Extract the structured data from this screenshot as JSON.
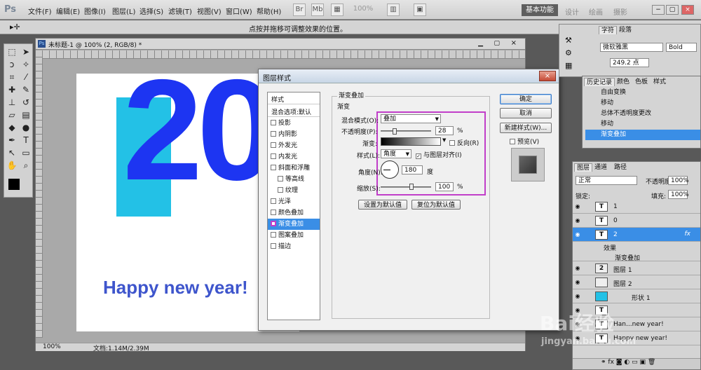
{
  "menubar": {
    "logo": "Ps",
    "items": [
      "文件(F)",
      "编辑(E)",
      "图像(I)",
      "图层(L)",
      "选择(S)",
      "滤镜(T)",
      "视图(V)",
      "窗口(W)",
      "帮助(H)"
    ],
    "zoom": "100%",
    "workspace_active": "基本功能",
    "workspaces": [
      "设计",
      "绘画",
      "摄影"
    ]
  },
  "optbar": {
    "hint": "点按并拖移可调整效果的位置。"
  },
  "document": {
    "tab_title": "未标题-1 @ 100% (2, RGB/8) *",
    "big_text": "20",
    "happy_text": "Happy new year!",
    "status_zoom": "100%",
    "status_doc": "文档:1.14M/2.39M"
  },
  "dialog": {
    "title": "图层样式",
    "close": "×",
    "styles_header": "样式",
    "blend_header": "混合选项:默认",
    "styles": [
      "投影",
      "内阴影",
      "外发光",
      "内发光",
      "斜面和浮雕",
      "等高线",
      "纹理",
      "光泽",
      "颜色叠加",
      "渐变叠加",
      "图案叠加",
      "描边"
    ],
    "selected_style": "渐变叠加",
    "group_title": "渐变叠加",
    "sub_title": "渐变",
    "blend_label": "混合模式(O):",
    "blend_value": "叠加",
    "opacity_label": "不透明度(P):",
    "opacity_value": "28",
    "opacity_unit": "%",
    "gradient_label": "渐变:",
    "reverse_label": "反向(R)",
    "style_label": "样式(L):",
    "style_value": "角度",
    "align_label": "与图层对齐(I)",
    "angle_label": "角度(N):",
    "angle_value": "180",
    "angle_unit": "度",
    "scale_label": "缩放(S):",
    "scale_value": "100",
    "scale_unit": "%",
    "btn_default": "设置为默认值",
    "btn_reset": "复位为默认值",
    "btn_ok": "确定",
    "btn_cancel": "取消",
    "btn_newstyle": "新建样式(W)...",
    "preview_label": "预览(V)"
  },
  "char_panel": {
    "tabs": [
      "字符",
      "段落"
    ],
    "font": "微软雅黑",
    "weight": "Bold",
    "size": "249.2 点"
  },
  "history_panel": {
    "tabs": [
      "历史记录",
      "颜色",
      "色板",
      "样式"
    ],
    "items": [
      "自由变换",
      "移动",
      "总体不透明度更改",
      "移动",
      "渐变叠加"
    ],
    "selected": "渐变叠加"
  },
  "layers_panel": {
    "tabs": [
      "图层",
      "通道",
      "路径"
    ],
    "blend": "正常",
    "opacity_label": "不透明度:",
    "opacity": "100%",
    "lock_label": "锁定:",
    "fill_label": "填充:",
    "fill": "100%",
    "layers": [
      {
        "name": "1",
        "kind": "T"
      },
      {
        "name": "0",
        "kind": "T"
      },
      {
        "name": "2",
        "kind": "T"
      },
      {
        "name": "效果",
        "kind": "sub"
      },
      {
        "name": "渐变叠加",
        "kind": "sub2"
      },
      {
        "name": "图层 1",
        "kind": "img"
      },
      {
        "name": "图层 2",
        "kind": "img"
      },
      {
        "name": "形状 1",
        "kind": "shape"
      },
      {
        "name": "",
        "kind": "T"
      },
      {
        "name": "Han...new year!",
        "kind": "T"
      },
      {
        "name": "Happy new year!",
        "kind": "T"
      }
    ],
    "fx": "fx"
  },
  "watermark": {
    "main": "Bai经验",
    "sub": "jingyan.baidu.com"
  }
}
